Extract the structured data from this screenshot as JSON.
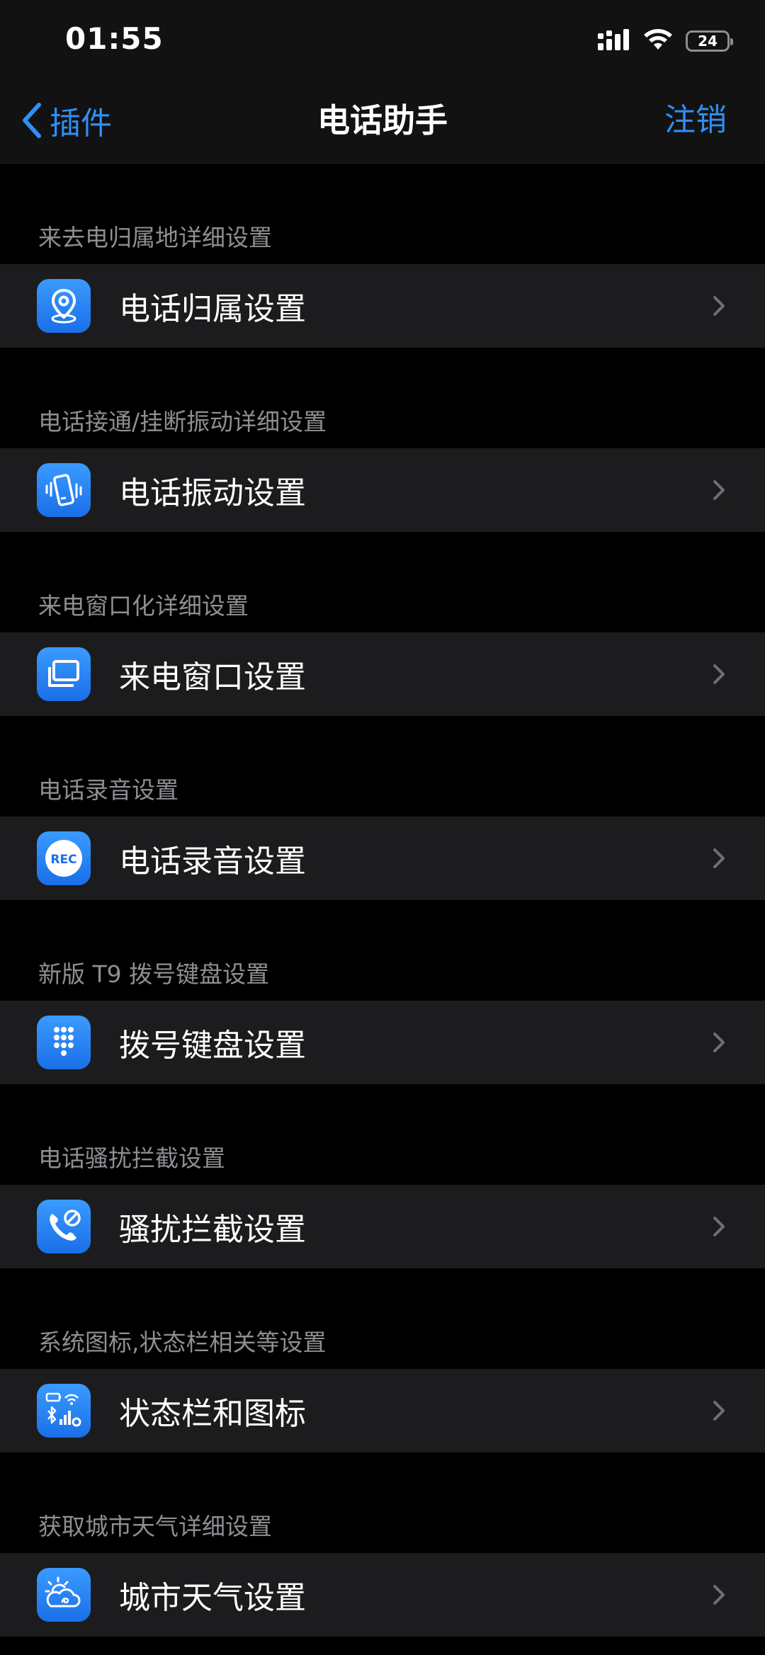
{
  "status_bar": {
    "time": "01:55",
    "battery": "24"
  },
  "nav": {
    "back_label": "插件",
    "title": "电话助手",
    "right_label": "注销"
  },
  "sections": [
    {
      "header": "来去电归属地详细设置",
      "label": "电话归属设置",
      "icon": "location-pin-icon"
    },
    {
      "header": "电话接通/挂断振动详细设置",
      "label": "电话振动设置",
      "icon": "phone-vibrate-icon"
    },
    {
      "header": "来电窗口化详细设置",
      "label": "来电窗口设置",
      "icon": "window-icon"
    },
    {
      "header": "电话录音设置",
      "label": "电话录音设置",
      "icon": "rec-icon"
    },
    {
      "header": "新版 T9 拨号键盘设置",
      "label": "拨号键盘设置",
      "icon": "keypad-icon"
    },
    {
      "header": "电话骚扰拦截设置",
      "label": "骚扰拦截设置",
      "icon": "phone-block-icon"
    },
    {
      "header": "系统图标,状态栏相关等设置",
      "label": "状态栏和图标",
      "icon": "status-icons-icon"
    },
    {
      "header": "获取城市天气详细设置",
      "label": "城市天气设置",
      "icon": "weather-icon"
    }
  ],
  "icons": {
    "rec_text": "REC"
  },
  "colors": {
    "accent": "#2f8ff5",
    "row_bg": "#1c1c1e",
    "header_text": "#8e8e93"
  }
}
